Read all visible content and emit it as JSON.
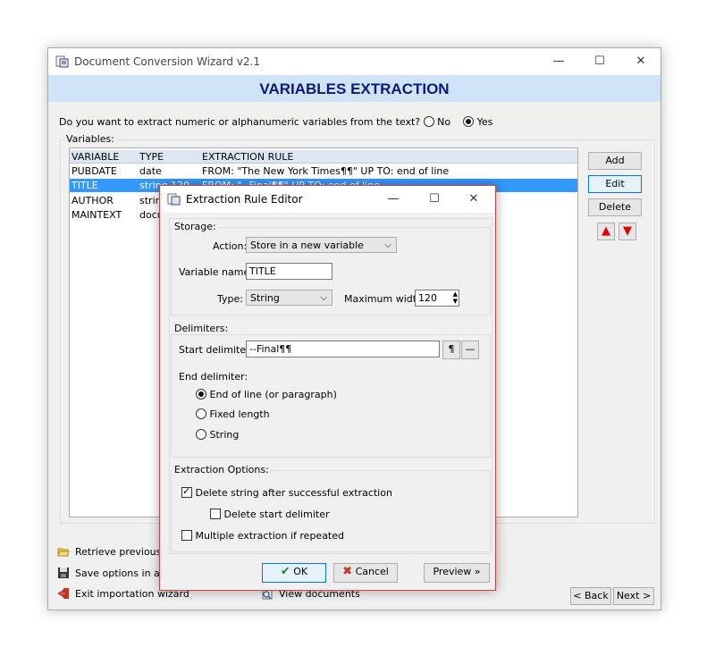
{
  "window": {
    "title": "Document Conversion Wizard v2.1",
    "header": "VARIABLES EXTRACTION",
    "minimize": "—",
    "maximize": "☐",
    "close": "✕"
  },
  "question": {
    "text": "Do you want to extract numeric or alphanumeric variables from the text?",
    "no_label": "No",
    "yes_label": "Yes",
    "selected": "Yes"
  },
  "variables": {
    "label": "Variables:",
    "columns": [
      "VARIABLE",
      "TYPE",
      "EXTRACTION RULE"
    ],
    "rows": [
      [
        "PUBDATE",
        "date",
        "FROM: \"The New York Times¶¶\"  UP TO: end of line"
      ],
      [
        "TITLE",
        "string 120",
        "FROM: \"--Final¶¶\"  UP TO: end of line"
      ],
      [
        "AUTHOR",
        "string",
        ""
      ],
      [
        "MAINTEXT",
        "document",
        ""
      ]
    ],
    "selected_row": 1
  },
  "buttons": {
    "add": "Add",
    "edit": "Edit",
    "delete": "Delete",
    "back": "< Back",
    "next": "Next >"
  },
  "side_actions": {
    "retrieve": "Retrieve previously saved options",
    "save": "Save options in a file",
    "exit": "Exit importation wizard",
    "view": "View documents"
  },
  "dialog": {
    "title": "Extraction Rule Editor",
    "minimize": "—",
    "maximize": "☐",
    "close": "✕",
    "storage_label": "Storage:",
    "action_label": "Action:",
    "action_value": "Store in a new variable",
    "varname_label": "Variable name:",
    "varname_value": "TITLE",
    "type_label": "Type:",
    "type_value": "String",
    "maxwidth_label": "Maximum width:",
    "maxwidth_value": "120",
    "delimiters_label": "Delimiters:",
    "start_label": "Start delimiter:",
    "start_value": "--Final¶¶",
    "pilcrow_btn": "¶",
    "dash_btn": "—",
    "end_label": "End delimiter:",
    "end_options": [
      "End of line (or paragraph)",
      "Fixed length",
      "String"
    ],
    "end_selected": 0,
    "options_label": "Extraction Options:",
    "opt_delete_string": "Delete string after successful extraction",
    "opt_delete_string_checked": true,
    "opt_delete_start": "Delete start delimiter",
    "opt_delete_start_checked": false,
    "opt_multiple": "Multiple extraction if repeated",
    "opt_multiple_checked": false,
    "ok": "OK",
    "cancel": "Cancel",
    "preview": "Preview »"
  },
  "colors": {
    "header_bg": "#cfe4f7",
    "header_text": "#0b1a7a",
    "selection": "#3399ff",
    "dialog_border": "#d04040"
  }
}
